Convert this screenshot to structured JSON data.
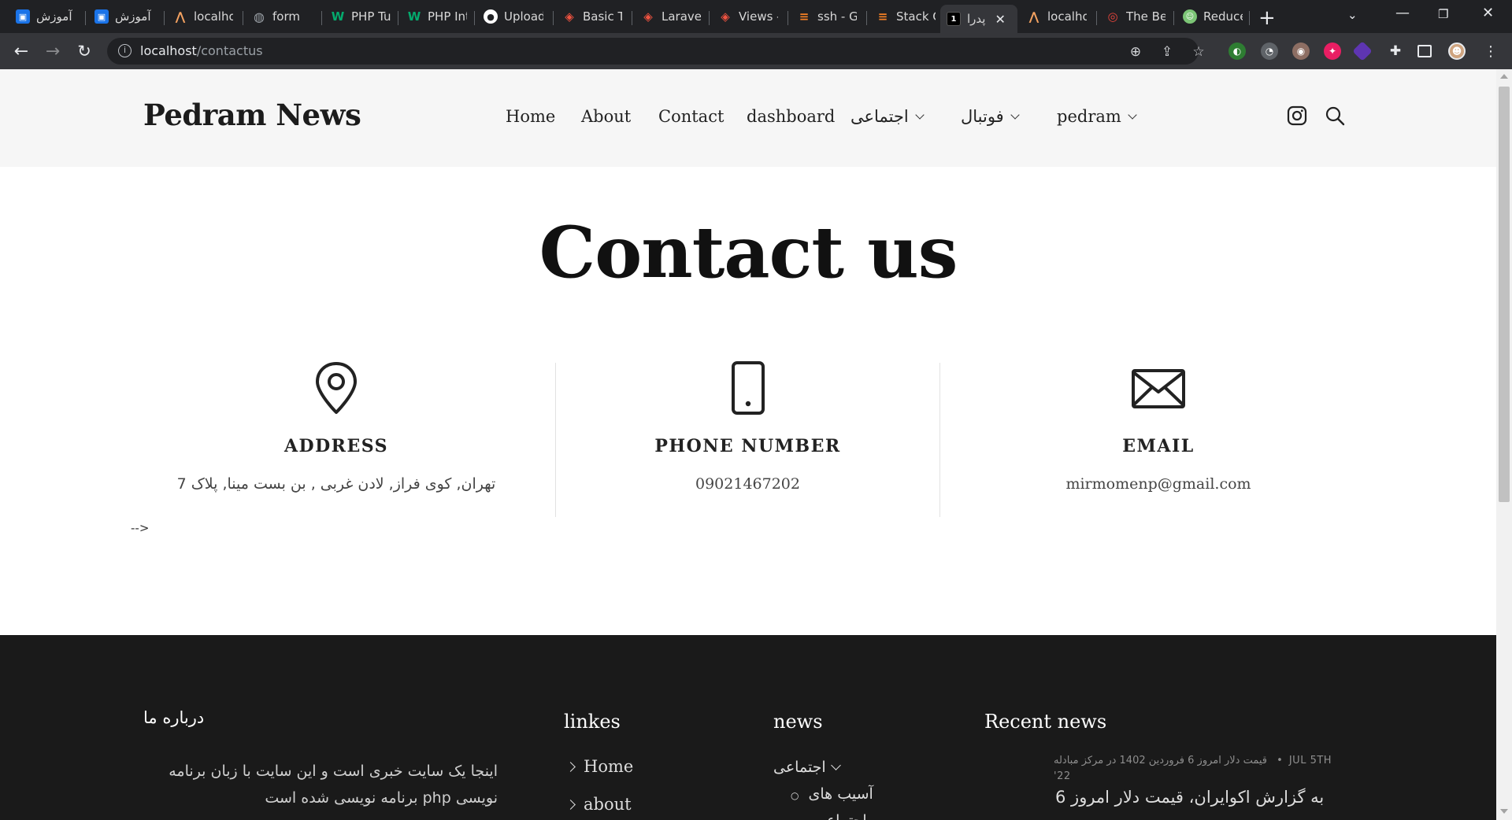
{
  "browser": {
    "tabs": [
      {
        "label": "آموزش",
        "favicon": "blue-badge-icon",
        "color": "#1a73e8"
      },
      {
        "label": "آموزش",
        "favicon": "blue-badge-icon",
        "color": "#1a73e8"
      },
      {
        "label": "localho",
        "favicon": "laravel-icon",
        "color": "#f4a261"
      },
      {
        "label": "form",
        "favicon": "globe-icon",
        "color": "#9aa0a6"
      },
      {
        "label": "PHP Tu",
        "favicon": "w3-icon",
        "color": "#04aa6d"
      },
      {
        "label": "PHP Int",
        "favicon": "w3-icon",
        "color": "#04aa6d"
      },
      {
        "label": "Upload",
        "favicon": "github-icon",
        "color": "#ffffff"
      },
      {
        "label": "Basic Ta",
        "favicon": "laravel-icon",
        "color": "#f05340"
      },
      {
        "label": "Laravel",
        "favicon": "laravel-icon",
        "color": "#f05340"
      },
      {
        "label": "Views -",
        "favicon": "laravel-icon",
        "color": "#f05340"
      },
      {
        "label": "ssh - G",
        "favicon": "stackoverflow-icon",
        "color": "#f48024"
      },
      {
        "label": "Stack C",
        "favicon": "stackoverflow-icon",
        "color": "#f48024"
      },
      {
        "label": "پدرا",
        "favicon": "numbered-tab-icon",
        "color": "#000000",
        "active": true
      },
      {
        "label": "localho",
        "favicon": "laravel-icon",
        "color": "#f4a261"
      },
      {
        "label": "The Be",
        "favicon": "target-icon",
        "color": "#e8453c"
      },
      {
        "label": "Reduce",
        "favicon": "robot-icon",
        "color": "#7cc576"
      }
    ],
    "url_host": "localhost",
    "url_path": "/contactus",
    "active_tab_number": "1"
  },
  "site": {
    "brand": "Pedram News",
    "nav": [
      {
        "label": "Home"
      },
      {
        "label": "About"
      },
      {
        "label": "Contact"
      },
      {
        "label": "dashboard"
      },
      {
        "label": "اجتماعی"
      },
      {
        "label": "فوتبال"
      },
      {
        "label": "pedram"
      }
    ]
  },
  "contact": {
    "title": "Contact us",
    "columns": [
      {
        "heading": "ADDRESS",
        "value": "تهران, کوی فراز, لادن غربی , بن بست مینا, پلاک 7",
        "icon": "map-pin-icon"
      },
      {
        "heading": "PHONE NUMBER",
        "value": "09021467202",
        "icon": "mobile-phone-icon"
      },
      {
        "heading": "EMAIL",
        "value": "mirmomenp@gmail.com",
        "icon": "envelope-icon"
      }
    ],
    "stray_text": "-->"
  },
  "footer": {
    "about_heading": "درباره ما",
    "about_text": "اینجا یک سایت خبری است و این سایت با زبان برنامه نویسی php برنامه نویسی شده است",
    "links_heading": "linkes",
    "links": [
      "Home",
      "about"
    ],
    "news_heading": "news",
    "news_category": "اجتماعی",
    "news_sub": [
      "آسیب های",
      "اجتماعی"
    ],
    "recent_heading": "Recent news",
    "recent_meta_date": "JUL 5TH '22",
    "recent_meta_text": "قیمت دلار امروز 6 فروردین 1402 در مرکز مبادله",
    "recent_title": "به گزارش اکوایران، قیمت دلار امروز 6"
  }
}
